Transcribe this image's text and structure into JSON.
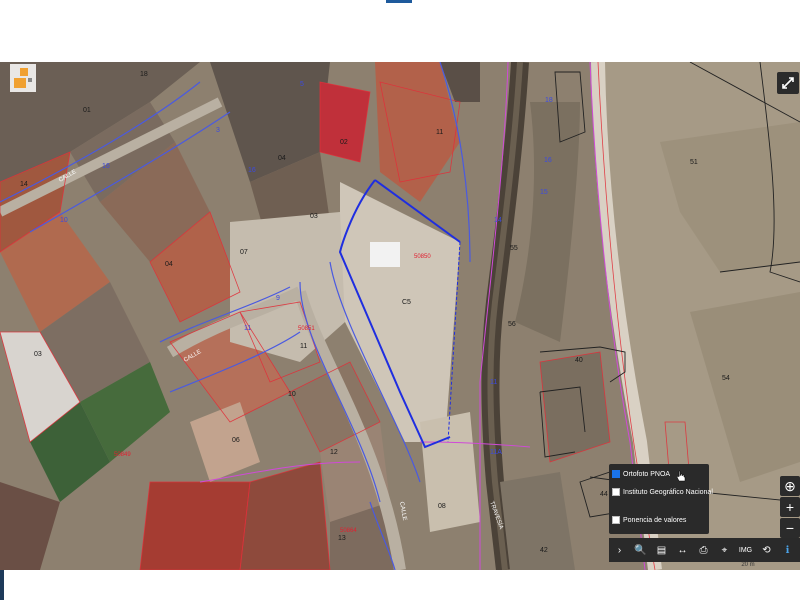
{
  "layers_panel": {
    "layers": [
      {
        "label": "Ortofoto PNOA",
        "checked": true
      },
      {
        "label": "Instituto Geográfico Nacional",
        "checked": false
      },
      {
        "label": "Ponencia de valores",
        "checked": false
      }
    ]
  },
  "toolbar": {
    "buttons": [
      {
        "name": "collapse-arrow-icon",
        "glyph": "›"
      },
      {
        "name": "search-icon",
        "glyph": "🔍"
      },
      {
        "name": "layers-icon",
        "glyph": "▤"
      },
      {
        "name": "measure-icon",
        "glyph": "↔"
      },
      {
        "name": "print-icon",
        "glyph": "⎙"
      },
      {
        "name": "location-pin-icon",
        "glyph": "⌖"
      },
      {
        "name": "img-icon",
        "glyph": "IMG"
      },
      {
        "name": "share-icon",
        "glyph": "⟲"
      },
      {
        "name": "info-icon",
        "glyph": "ℹ"
      }
    ]
  },
  "scale_label": "20 m",
  "zoom": {
    "plus": "+",
    "minus": "−",
    "locate": "⊕"
  },
  "map_labels": {
    "parcel_numbers": [
      "18",
      "01",
      "14",
      "02",
      "04",
      "03",
      "11",
      "07",
      "05",
      "06",
      "51",
      "13",
      "15",
      "16",
      "17",
      "12",
      "10",
      "08",
      "09",
      "42",
      "40",
      "55",
      "56",
      "54",
      "61"
    ],
    "streets": [
      "CALLE",
      "TRAVESÍA",
      "CALLE",
      "CALLE"
    ],
    "block_codes": [
      "C5",
      "50850",
      "50851",
      "50849",
      "50870",
      "50864"
    ]
  }
}
